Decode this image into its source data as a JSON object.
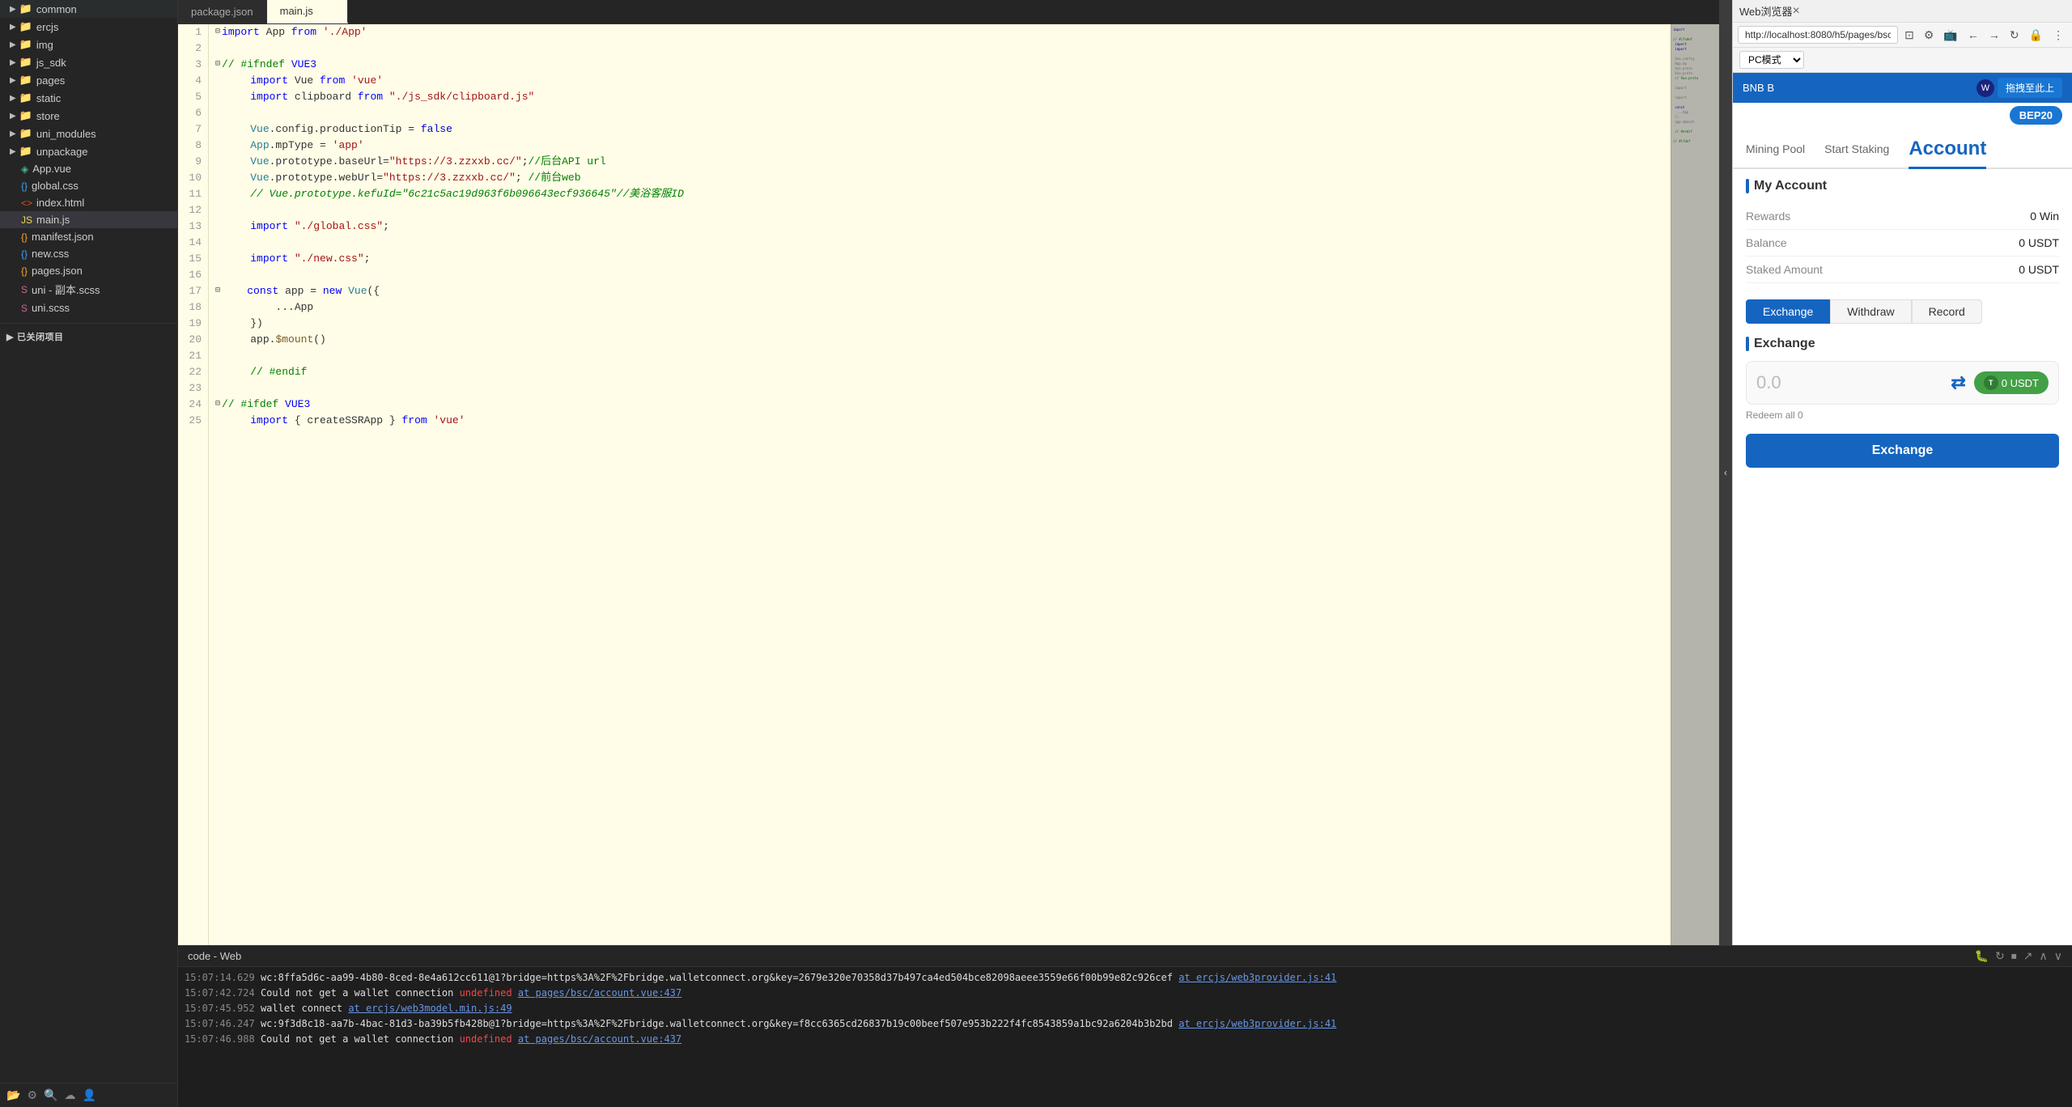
{
  "sidebar": {
    "items": [
      {
        "label": "common",
        "type": "folder",
        "expanded": true
      },
      {
        "label": "ercjs",
        "type": "folder",
        "expanded": true
      },
      {
        "label": "img",
        "type": "folder",
        "expanded": true
      },
      {
        "label": "js_sdk",
        "type": "folder",
        "expanded": true
      },
      {
        "label": "pages",
        "type": "folder",
        "expanded": true
      },
      {
        "label": "static",
        "type": "folder",
        "expanded": true
      },
      {
        "label": "store",
        "type": "folder",
        "expanded": true
      },
      {
        "label": "uni_modules",
        "type": "folder",
        "expanded": true
      },
      {
        "label": "unpackage",
        "type": "folder",
        "expanded": true
      },
      {
        "label": "App.vue",
        "type": "file-vue"
      },
      {
        "label": "global.css",
        "type": "file-css"
      },
      {
        "label": "index.html",
        "type": "file-html"
      },
      {
        "label": "main.js",
        "type": "file-js",
        "active": true
      },
      {
        "label": "manifest.json",
        "type": "file-json"
      },
      {
        "label": "new.css",
        "type": "file-css"
      },
      {
        "label": "pages.json",
        "type": "file-json"
      },
      {
        "label": "uni - 副本.scss",
        "type": "file-scss"
      },
      {
        "label": "uni.scss",
        "type": "file-scss"
      }
    ],
    "closed_projects_label": "已关闭项目"
  },
  "editor": {
    "tabs": [
      {
        "label": "package.json",
        "active": false
      },
      {
        "label": "main.js",
        "active": true
      }
    ],
    "lines": [
      {
        "num": 1,
        "content": "import App from './App'",
        "tokens": [
          {
            "t": "kw",
            "v": "import"
          },
          {
            "t": "plain",
            "v": " App "
          },
          {
            "t": "kw",
            "v": "from"
          },
          {
            "t": "str",
            "v": " './App'"
          }
        ]
      },
      {
        "num": 2,
        "content": ""
      },
      {
        "num": 3,
        "content": "// #ifndef VUE3",
        "comment": true
      },
      {
        "num": 4,
        "content": "    import Vue from 'vue'"
      },
      {
        "num": 5,
        "content": "    import clipboard from \"./js_sdk/clipboard.js\""
      },
      {
        "num": 6,
        "content": ""
      },
      {
        "num": 7,
        "content": "    Vue.config.productionTip = false"
      },
      {
        "num": 8,
        "content": "    App.mpType = 'app'"
      },
      {
        "num": 9,
        "content": "    Vue.prototype.baseUrl=\"https://3.zzxxb.cc/\";//后台API url"
      },
      {
        "num": 10,
        "content": "    Vue.prototype.webUrl=\"https://3.zzxxb.cc/\"; //前台web"
      },
      {
        "num": 11,
        "content": "    // Vue.prototype.kefuId=\"6c21c5ac19d963f6b096643ecf936645\"//美浴客服ID",
        "comment": true
      },
      {
        "num": 12,
        "content": ""
      },
      {
        "num": 13,
        "content": "    import \"./global.css\";"
      },
      {
        "num": 14,
        "content": ""
      },
      {
        "num": 15,
        "content": "    import \"./new.css\";"
      },
      {
        "num": 16,
        "content": ""
      },
      {
        "num": 17,
        "content": "    const app = new Vue({"
      },
      {
        "num": 18,
        "content": "        ...App"
      },
      {
        "num": 19,
        "content": "    })"
      },
      {
        "num": 20,
        "content": "    app.$mount()"
      },
      {
        "num": 21,
        "content": ""
      },
      {
        "num": 22,
        "content": "    // #endif",
        "comment": true
      },
      {
        "num": 23,
        "content": ""
      },
      {
        "num": 24,
        "content": "// #ifdef VUE3",
        "comment": true
      },
      {
        "num": 25,
        "content": "    import { createSSRApp } from 'vue'"
      }
    ]
  },
  "console": {
    "title": "code - Web",
    "logs": [
      {
        "time": "15:07:14.629",
        "msg": "wc:8ffa5d6c-aa99-4b80-8ced-8e4a612cc611@1?bridge=https%3A%2F%2Fbridge.walletconnect.org&key=2679e320e70358d37b497ca4ed504bce82098aeee3559e66f00b99e82c926cef",
        "link": "at ercjs/web3provider.js:41"
      },
      {
        "time": "15:07:42.724",
        "level": "error",
        "msg": "Could not get a wallet connection",
        "keyword": "undefined",
        "link": "at pages/bsc/account.vue:437"
      },
      {
        "time": "15:07:45.952",
        "msg": "wallet connect",
        "link": "at ercjs/web3model.min.js:49"
      },
      {
        "time": "15:07:46.247",
        "msg": "wc:9f3d8c18-aa7b-4bac-81d3-ba39b5fb428b@1?bridge=https%3A%2F%2Fbridge.walletconnect.org&key=f8cc6365cd26837b19c00beef507e953b222f4fc8543859a1bc92a6204b3b2bd",
        "link": "at ercjs/web3provider.js:41"
      },
      {
        "time": "15:07:46.988",
        "level": "error",
        "msg": "Could not get a wallet connection",
        "keyword": "undefined",
        "link": "at pages/bsc/account.vue:437"
      }
    ]
  },
  "browser": {
    "title": "Web浏览器",
    "url": "http://localhost:8080/h5/pages/bsc/account",
    "mode": "PC模式",
    "blue_bar_text": "BNB B",
    "pin_btn": "拖拽至此上",
    "bep20": "BEP20",
    "tabs": [
      {
        "label": "Mining Pool"
      },
      {
        "label": "Start Staking"
      },
      {
        "label": "Account",
        "active": true
      }
    ],
    "my_account": {
      "title": "My Account",
      "rows": [
        {
          "label": "Rewards",
          "value": "0 Win"
        },
        {
          "label": "Balance",
          "value": "0 USDT"
        },
        {
          "label": "Staked Amount",
          "value": "0 USDT"
        }
      ]
    },
    "action_tabs": [
      {
        "label": "Exchange",
        "active": true
      },
      {
        "label": "Withdraw"
      },
      {
        "label": "Record"
      }
    ],
    "exchange": {
      "title": "Exchange",
      "input_value": "0.0",
      "token_label": "0 USDT",
      "redeem_label": "Redeem all 0",
      "button_label": "Exchange"
    }
  }
}
